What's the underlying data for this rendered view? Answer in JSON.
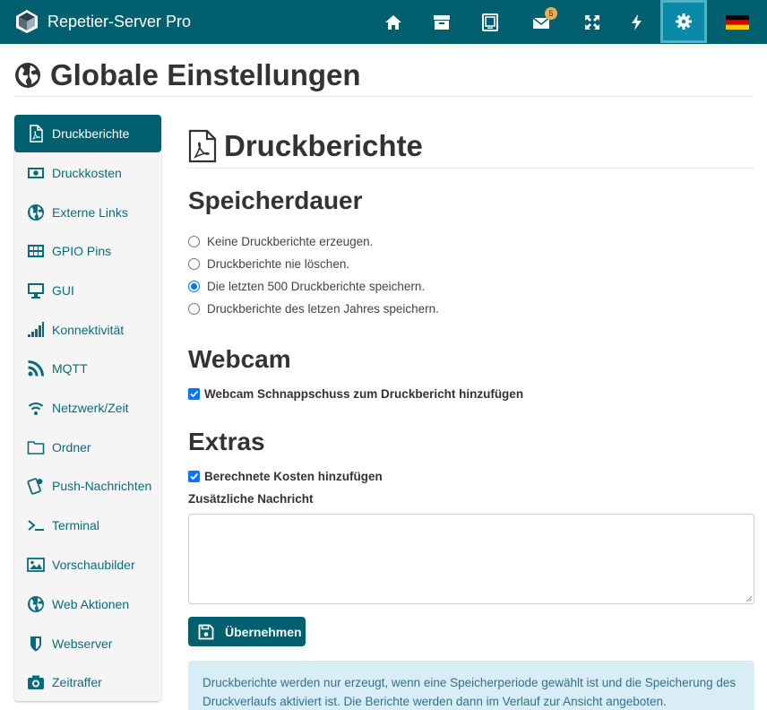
{
  "app": {
    "title": "Repetier-Server Pro"
  },
  "topnav": {
    "messages_badge": "5"
  },
  "page": {
    "title": "Globale Einstellungen"
  },
  "sidebar": {
    "items": [
      {
        "label": "Druckberichte",
        "icon": "pdf-file-icon"
      },
      {
        "label": "Druckkosten",
        "icon": "money-icon"
      },
      {
        "label": "Externe Links",
        "icon": "globe-icon"
      },
      {
        "label": "GPIO Pins",
        "icon": "grid-icon"
      },
      {
        "label": "GUI",
        "icon": "monitor-icon"
      },
      {
        "label": "Konnektivität",
        "icon": "signal-icon"
      },
      {
        "label": "MQTT",
        "icon": "rss-icon"
      },
      {
        "label": "Netzwerk/Zeit",
        "icon": "wifi-icon"
      },
      {
        "label": "Ordner",
        "icon": "folder-icon"
      },
      {
        "label": "Push-Nachrichten",
        "icon": "phone-icon"
      },
      {
        "label": "Terminal",
        "icon": "terminal-icon"
      },
      {
        "label": "Vorschaubilder",
        "icon": "image-icon"
      },
      {
        "label": "Web Aktionen",
        "icon": "globe-icon"
      },
      {
        "label": "Webserver",
        "icon": "shield-icon"
      },
      {
        "label": "Zeitraffer",
        "icon": "camera-icon"
      }
    ]
  },
  "main": {
    "title": "Druckberichte",
    "storage": {
      "heading": "Speicherdauer",
      "options": [
        "Keine Druckberichte erzeugen.",
        "Druckberichte nie löschen.",
        "Die letzten 500 Druckberichte speichern.",
        "Druckberichte des letzen Jahres speichern."
      ],
      "selected_index": 2
    },
    "webcam": {
      "heading": "Webcam",
      "checkbox_label": "Webcam Schnappschuss zum Druckbericht hinzufügen"
    },
    "extras": {
      "heading": "Extras",
      "costs_label": "Berechnete Kosten hinzufügen",
      "message_label": "Zusätzliche Nachricht",
      "message_value": ""
    },
    "save_label": "Übernehmen",
    "info_text": "Druckberichte werden nur erzeugt, wenn eine Speicherperiode gewählt ist und die Speicherung des Druckverlaufs aktiviert ist. Die Berichte werden dann im Verlauf zur Ansicht angeboten."
  },
  "colors": {
    "primary": "#005f6e",
    "active_nav": "#0a8aa8",
    "link": "#0b6b7e",
    "info_bg": "#d9edf7"
  }
}
